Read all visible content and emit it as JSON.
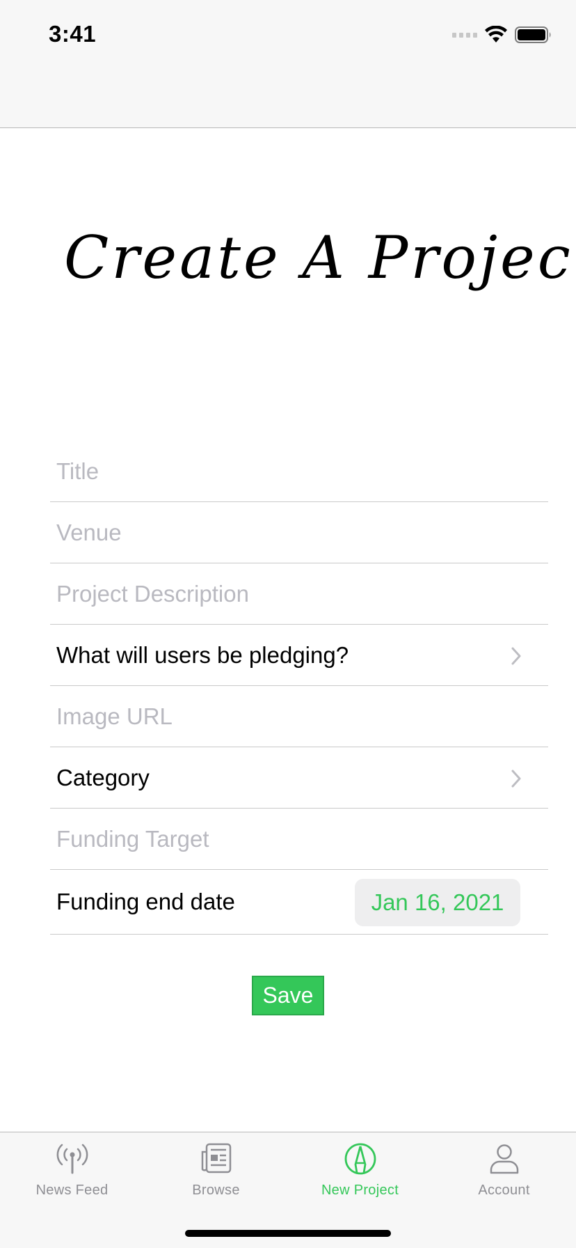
{
  "status_bar": {
    "time": "3:41"
  },
  "page": {
    "title": "Create A Project"
  },
  "form": {
    "title_placeholder": "Title",
    "venue_placeholder": "Venue",
    "description_placeholder": "Project Description",
    "pledging_label": "What will users be pledging?",
    "image_url_placeholder": "Image URL",
    "category_label": "Category",
    "funding_target_placeholder": "Funding Target",
    "funding_end_date_label": "Funding end date",
    "funding_end_date_value": "Jan 16, 2021",
    "save_label": "Save"
  },
  "tabs": [
    {
      "label": "News Feed",
      "icon": "antenna-icon",
      "active": false
    },
    {
      "label": "Browse",
      "icon": "newspaper-icon",
      "active": false
    },
    {
      "label": "New Project",
      "icon": "pencil-circle-icon",
      "active": true
    },
    {
      "label": "Account",
      "icon": "person-icon",
      "active": false
    }
  ],
  "colors": {
    "accent": "#34c759",
    "placeholder": "#b9b9c0",
    "inactive_tab": "#8e8e93"
  }
}
